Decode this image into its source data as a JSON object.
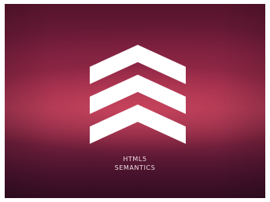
{
  "slide": {
    "caption_line1": "HTML5",
    "caption_line2": "SEMANTICS",
    "icon": "stacked-chevrons-up-icon",
    "colors": {
      "background_dark": "#3d0f28",
      "background_mid": "#8c2645",
      "glow": "#d64a62",
      "logo": "#ffffff",
      "text": "#f1dbe1"
    }
  }
}
